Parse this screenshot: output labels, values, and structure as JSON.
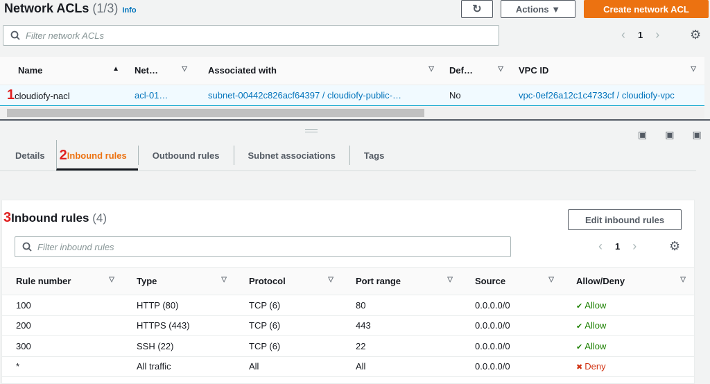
{
  "header": {
    "title": "Network ACLs",
    "count": "(1/3)",
    "info": "Info",
    "actions": "Actions ▼",
    "create": "Create network ACL",
    "filter_placeholder": "Filter network ACLs",
    "page": "1"
  },
  "acl_table": {
    "columns": [
      "Name",
      "Net…",
      "Associated with",
      "Def…",
      "VPC ID"
    ],
    "row": {
      "marker": "1",
      "name": "cloudiofy-nacl",
      "id": "acl-01…",
      "associated": "subnet-00442c826acf64397 / cloudiofy-public-…",
      "default": "No",
      "vpc": "vpc-0ef26a12c1c4733cf / cloudiofy-vpc"
    }
  },
  "tabs": [
    {
      "label": "Details"
    },
    {
      "label": "Inbound rules",
      "marker": "2"
    },
    {
      "label": "Outbound rules"
    },
    {
      "label": "Subnet associations"
    },
    {
      "label": "Tags"
    }
  ],
  "inbound": {
    "marker": "3",
    "title": "Inbound rules",
    "count": "(4)",
    "edit": "Edit inbound rules",
    "filter_placeholder": "Filter inbound rules",
    "page": "1",
    "columns": [
      "Rule number",
      "Type",
      "Protocol",
      "Port range",
      "Source",
      "Allow/Deny"
    ],
    "rows": [
      [
        "100",
        "HTTP (80)",
        "TCP (6)",
        "80",
        "0.0.0.0/0",
        "Allow"
      ],
      [
        "200",
        "HTTPS (443)",
        "TCP (6)",
        "443",
        "0.0.0.0/0",
        "Allow"
      ],
      [
        "300",
        "SSH (22)",
        "TCP (6)",
        "22",
        "0.0.0.0/0",
        "Allow"
      ],
      [
        "*",
        "All traffic",
        "All",
        "All",
        "0.0.0.0/0",
        "Deny"
      ]
    ]
  },
  "colors": {
    "accent": "#ec7211",
    "link": "#0073bb",
    "allow": "#1d8102",
    "deny": "#d13212"
  }
}
